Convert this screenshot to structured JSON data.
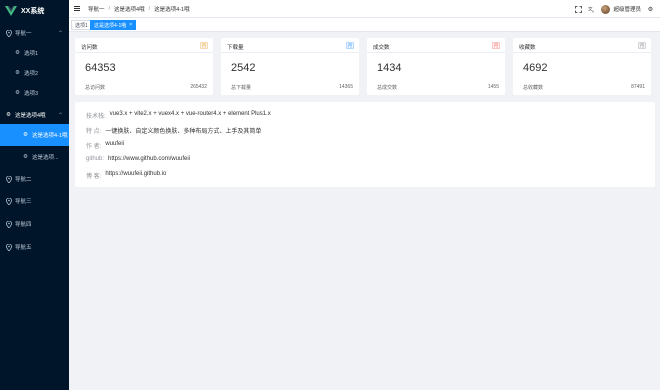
{
  "app": {
    "title": "XX系统"
  },
  "sidebar": {
    "items": [
      {
        "label": "导航一",
        "icon": "location-icon"
      },
      {
        "label": "选项1",
        "icon": "gear-icon"
      },
      {
        "label": "选项2",
        "icon": "gear-icon"
      },
      {
        "label": "选项3",
        "icon": "gear-icon"
      },
      {
        "label": "这是选项4哦",
        "icon": "gear-icon"
      },
      {
        "label": "这是选项4-1哦",
        "icon": "gear-icon"
      },
      {
        "label": "这是选项...",
        "icon": "gear-icon"
      },
      {
        "label": "导航二",
        "icon": "location-icon"
      },
      {
        "label": "导航三",
        "icon": "location-icon"
      },
      {
        "label": "导航四",
        "icon": "location-icon"
      },
      {
        "label": "导航五",
        "icon": "location-icon"
      }
    ]
  },
  "header": {
    "breadcrumb": [
      "导航一",
      "这是选项4哦",
      "这是选项4-1哦"
    ],
    "user_name": "超级管理员"
  },
  "tabs": [
    {
      "label": "选项1",
      "active": false
    },
    {
      "label": "这是选项4-1哦",
      "active": true,
      "close": "×"
    }
  ],
  "cards": [
    {
      "title": "访问数",
      "badge": "月",
      "badge_color": "#e6a23c",
      "badge_bg": "#fdf6ec",
      "value": "64353",
      "total_label": "总访问数",
      "total_value": "265432"
    },
    {
      "title": "下载量",
      "badge": "月",
      "badge_color": "#409eff",
      "badge_bg": "#ecf5ff",
      "value": "2542",
      "total_label": "总下载量",
      "total_value": "14365"
    },
    {
      "title": "成交数",
      "badge": "月",
      "badge_color": "#f56c6c",
      "badge_bg": "#fef0f0",
      "value": "1434",
      "total_label": "总成交数",
      "total_value": "1455"
    },
    {
      "title": "收藏数",
      "badge": "月",
      "badge_color": "#909399",
      "badge_bg": "#f4f4f5",
      "value": "4692",
      "total_label": "总收藏数",
      "total_value": "87491"
    }
  ],
  "info": {
    "tech_key": "技术栈:",
    "tech_val": "vue3.x + vite2.x + vuex4.x + vue-router4.x + element Plus1.x",
    "feat_key": "特 点:",
    "feat_val": "一键换肤、自定义颜色换肤、多种布局方式、上手及其简单",
    "author_key": "作 者:",
    "author_val": "wuufeii",
    "github_key": "github:",
    "github_val": "https://www.github.com/wuufeii",
    "blog_key": "博 客:",
    "blog_val": "https://wuufeii.github.io"
  },
  "colors": {
    "sidebar_bg": "#001529",
    "accent": "#1890ff",
    "logo_green": "#42b883"
  }
}
